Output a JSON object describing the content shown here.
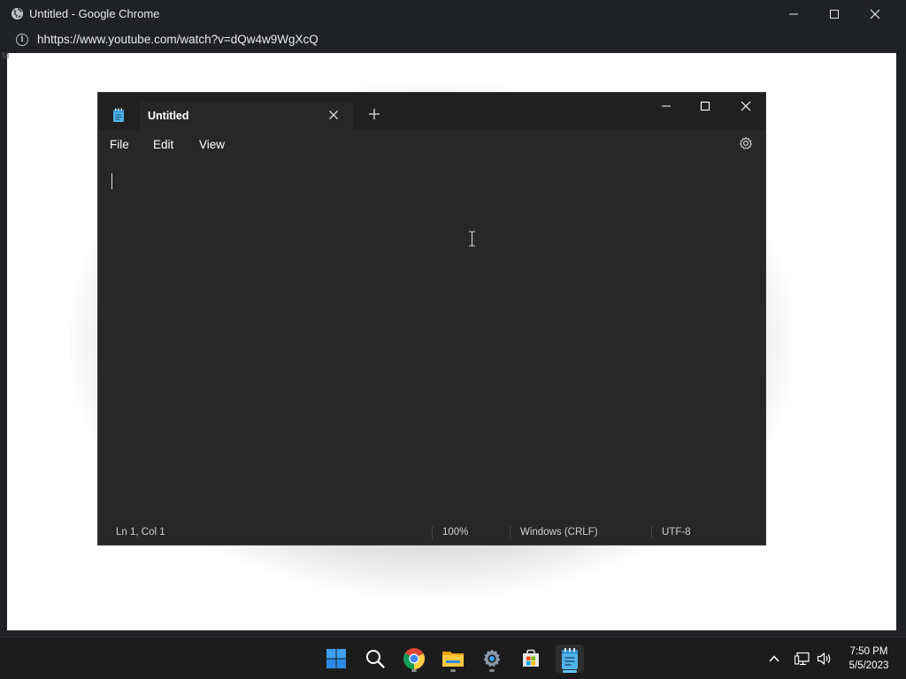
{
  "browser": {
    "window_title": "Untitled - Google Chrome",
    "url": "hhttps://www.youtube.com/watch?v=dQw4w9WgXcQ",
    "edge_char": "M",
    "icons": {
      "favicon": "globe-icon",
      "info": "info-icon"
    },
    "info_glyph": "i"
  },
  "notepad": {
    "tab_title": "Untitled",
    "menu": [
      "File",
      "Edit",
      "View"
    ],
    "status": {
      "position": "Ln 1, Col 1",
      "zoom": "100%",
      "line_ending": "Windows (CRLF)",
      "encoding": "UTF-8"
    },
    "editor_text": "",
    "colors": {
      "background": "#272727",
      "tab_strip": "#202020",
      "text": "#ffffff"
    }
  },
  "taskbar": {
    "apps": [
      "start-icon",
      "search-icon",
      "chrome-icon",
      "file-explorer-icon",
      "settings-icon",
      "microsoft-store-icon",
      "notepad-icon"
    ],
    "active_app": "notepad-icon",
    "clock": {
      "time": "7:50 PM",
      "date": "5/5/2023"
    },
    "colors": {
      "background": "#1c1c1c",
      "active_indicator": "#5cc8ff"
    }
  }
}
